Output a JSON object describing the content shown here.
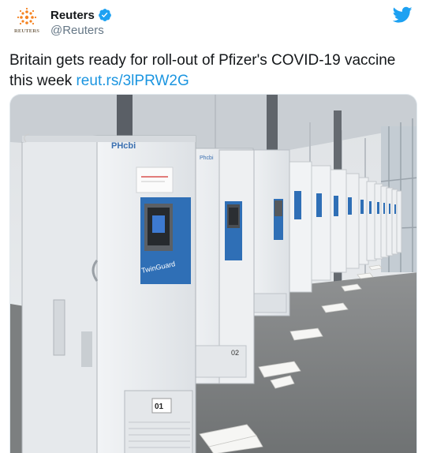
{
  "account": {
    "display_name": "Reuters",
    "handle": "@Reuters",
    "avatar_wordmark": "REUTERS",
    "verified": true
  },
  "tweet": {
    "text": "Britain gets ready for roll-out of Pfizer's COVID-19 vaccine this week",
    "link": "reut.rs/3lPRW2G"
  },
  "photo": {
    "brand": "PHcbi",
    "panel_label": "TwinGuard",
    "unit_labels": [
      "01",
      "02"
    ]
  },
  "colors": {
    "link": "#1b95e0",
    "twitter_blue": "#1da1f2",
    "text": "#14171a",
    "secondary": "#657786"
  },
  "icons": {
    "verified": "verified-badge-icon",
    "platform": "twitter-bird-icon"
  }
}
